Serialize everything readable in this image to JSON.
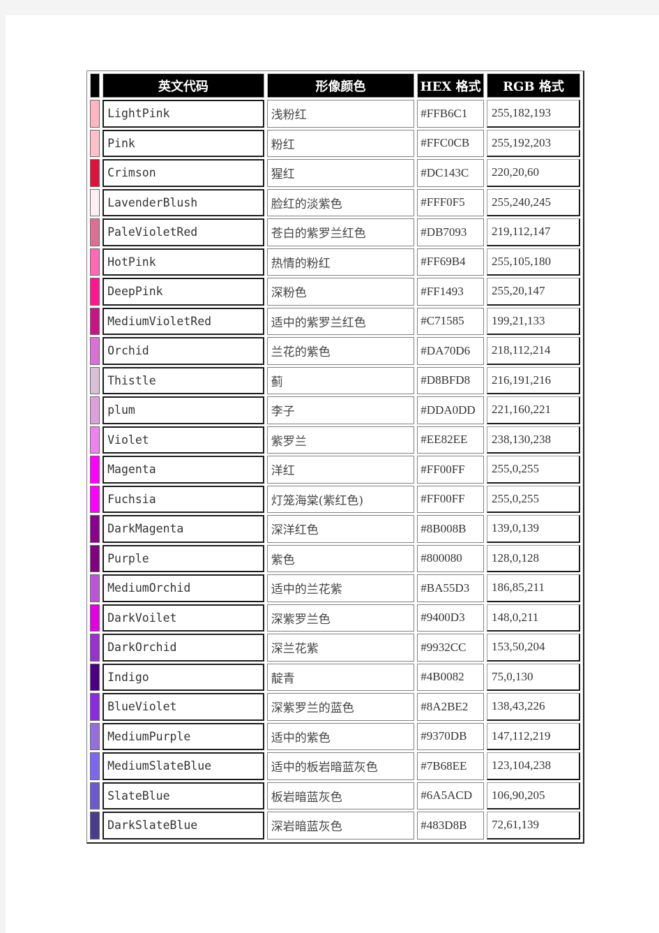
{
  "table": {
    "headers": {
      "swatch": "",
      "name": "英文代码",
      "cn": "形像颜色",
      "hex": "HEX 格式",
      "rgb": "RGB 格式"
    },
    "rows": [
      {
        "name": "LightPink",
        "cn": "浅粉红",
        "hex": "#FFB6C1",
        "rgb": "255,182,193",
        "swatch": "#FFB6C1"
      },
      {
        "name": "Pink",
        "cn": "粉红",
        "hex": "#FFC0CB",
        "rgb": "255,192,203",
        "swatch": "#FFC0CB"
      },
      {
        "name": "Crimson",
        "cn": "猩红",
        "hex": "#DC143C",
        "rgb": "220,20,60",
        "swatch": "#DC143C"
      },
      {
        "name": "LavenderBlush",
        "cn": "脸红的淡紫色",
        "hex": "#FFF0F5",
        "rgb": "255,240,245",
        "swatch": "#FFF0F5"
      },
      {
        "name": "PaleVioletRed",
        "cn": "苍白的紫罗兰红色",
        "hex": "#DB7093",
        "rgb": "219,112,147",
        "swatch": "#DB7093"
      },
      {
        "name": "HotPink",
        "cn": "热情的粉红",
        "hex": "#FF69B4",
        "rgb": "255,105,180",
        "swatch": "#FF69B4"
      },
      {
        "name": "DeepPink",
        "cn": "深粉色",
        "hex": "#FF1493",
        "rgb": "255,20,147",
        "swatch": "#FF1493"
      },
      {
        "name": "MediumVioletRed",
        "cn": "适中的紫罗兰红色",
        "hex": "#C71585",
        "rgb": "199,21,133",
        "swatch": "#C71585"
      },
      {
        "name": "Orchid",
        "cn": "兰花的紫色",
        "hex": "#DA70D6",
        "rgb": "218,112,214",
        "swatch": "#DA70D6"
      },
      {
        "name": "Thistle",
        "cn": "蓟",
        "hex": "#D8BFD8",
        "rgb": "216,191,216",
        "swatch": "#D8BFD8"
      },
      {
        "name": "plum",
        "cn": "李子",
        "hex": "#DDA0DD",
        "rgb": "221,160,221",
        "swatch": "#DDA0DD"
      },
      {
        "name": "Violet",
        "cn": "紫罗兰",
        "hex": "#EE82EE",
        "rgb": "238,130,238",
        "swatch": "#EE82EE"
      },
      {
        "name": "Magenta",
        "cn": "洋红",
        "hex": "#FF00FF",
        "rgb": "255,0,255",
        "swatch": "#FF00FF"
      },
      {
        "name": "Fuchsia",
        "cn": "灯笼海棠(紫红色)",
        "hex": "#FF00FF",
        "rgb": "255,0,255",
        "swatch": "#FF00FF"
      },
      {
        "name": "DarkMagenta",
        "cn": "深洋红色",
        "hex": "#8B008B",
        "rgb": "139,0,139",
        "swatch": "#8B008B"
      },
      {
        "name": "Purple",
        "cn": "紫色",
        "hex": "#800080",
        "rgb": "128,0,128",
        "swatch": "#800080"
      },
      {
        "name": "MediumOrchid",
        "cn": "适中的兰花紫",
        "hex": "#BA55D3",
        "rgb": "186,85,211",
        "swatch": "#BA55D3"
      },
      {
        "name": "DarkVoilet",
        "cn": "深紫罗兰色",
        "hex": "#9400D3",
        "rgb": "148,0,211",
        "swatch": "#E000E0"
      },
      {
        "name": "DarkOrchid",
        "cn": "深兰花紫",
        "hex": "#9932CC",
        "rgb": "153,50,204",
        "swatch": "#9932CC"
      },
      {
        "name": "Indigo",
        "cn": "靛青",
        "hex": "#4B0082",
        "rgb": "75,0,130",
        "swatch": "#4B0082"
      },
      {
        "name": "BlueViolet",
        "cn": "深紫罗兰的蓝色",
        "hex": "#8A2BE2",
        "rgb": "138,43,226",
        "swatch": "#8A2BE2"
      },
      {
        "name": "MediumPurple",
        "cn": "适中的紫色",
        "hex": "#9370DB",
        "rgb": "147,112,219",
        "swatch": "#9370DB"
      },
      {
        "name": "MediumSlateBlue",
        "cn": "适中的板岩暗蓝灰色",
        "hex": "#7B68EE",
        "rgb": "123,104,238",
        "swatch": "#7B68EE"
      },
      {
        "name": "SlateBlue",
        "cn": "板岩暗蓝灰色",
        "hex": "#6A5ACD",
        "rgb": "106,90,205",
        "swatch": "#6A5ACD"
      },
      {
        "name": "DarkSlateBlue",
        "cn": "深岩暗蓝灰色",
        "hex": "#483D8B",
        "rgb": "72,61,139",
        "swatch": "#483D8B"
      }
    ]
  }
}
